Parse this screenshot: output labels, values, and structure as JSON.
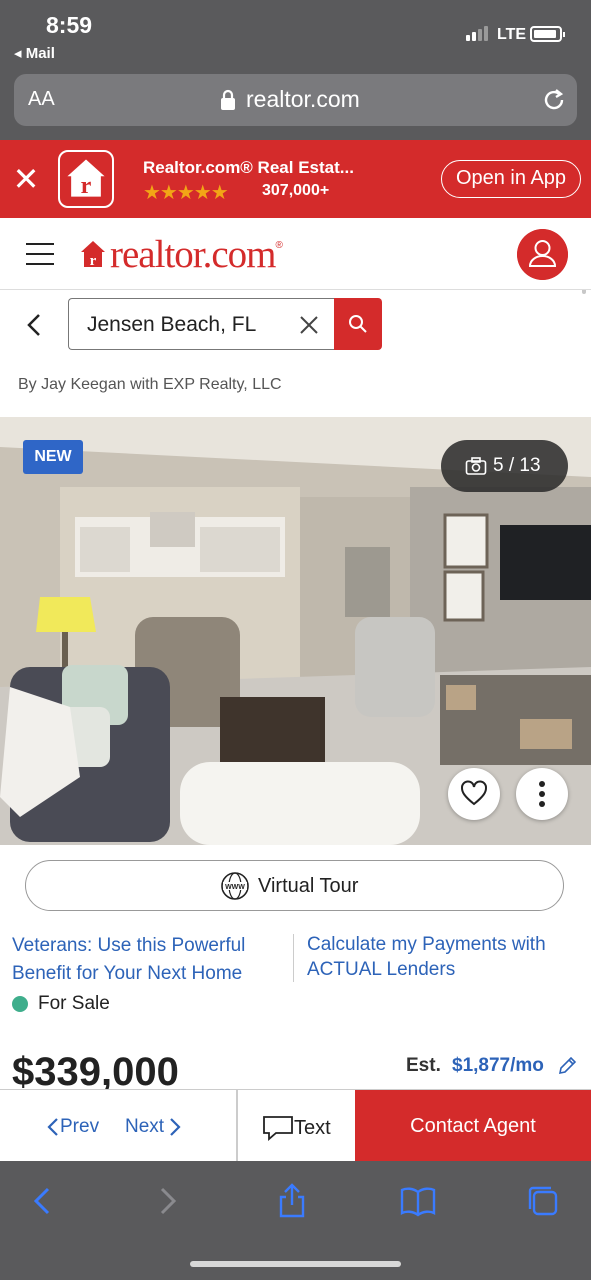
{
  "status_bar": {
    "time": "8:59",
    "back_app": "◂ Mail",
    "network": "LTE"
  },
  "browser": {
    "text_size": "AA",
    "url": "realtor.com"
  },
  "app_banner": {
    "title": "Realtor.com® Real Estat...",
    "stars": "★★★★★",
    "rating_count": "307,000+",
    "open_label": "Open in App",
    "accent": "#d42b2b"
  },
  "header": {
    "logo_text": "realtor.com",
    "logo_reg": "®"
  },
  "search": {
    "value": "Jensen Beach, FL"
  },
  "listing": {
    "byline": "By Jay Keegan with EXP Realty, LLC",
    "badge": "NEW",
    "photo_counter": "5 / 13",
    "virtual_tour_label": "Virtual Tour",
    "promo_left": "Veterans: Use this Powerful Benefit for Your Next Home",
    "promo_right": "Calculate my Payments with ACTUAL Lenders",
    "status": "For Sale",
    "status_color": "#3fae8c",
    "price": "$339,000",
    "est_label": "Est.",
    "est_amount": "$1,877/mo"
  },
  "action_bar": {
    "prev": "Prev",
    "next": "Next",
    "text": "Text",
    "contact": "Contact Agent"
  },
  "safari_toolbar": {
    "icons": [
      "back-icon",
      "forward-icon",
      "share-icon",
      "bookmarks-icon",
      "tabs-icon"
    ]
  }
}
